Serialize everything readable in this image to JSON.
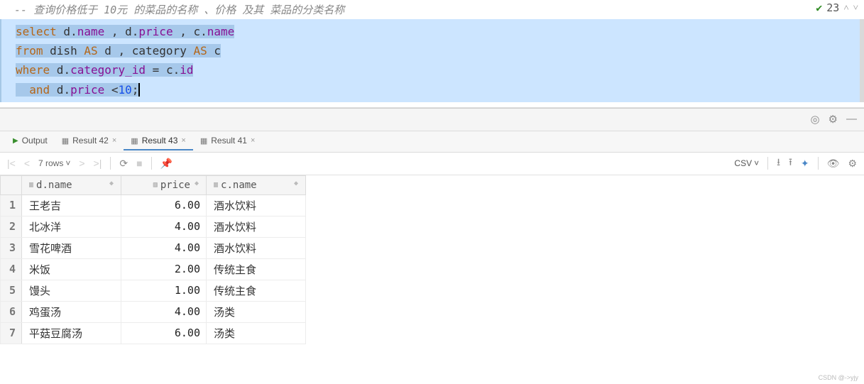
{
  "editor": {
    "comment": "--  查询价格低于 10元  的菜品的名称  、价格  及其  菜品的分类名称",
    "problems_count": "23",
    "code_tokens": {
      "l1": "select d.name , d.price , c.name",
      "l2": "from dish AS d , category AS c",
      "l3": "where d.category_id = c.id",
      "l4": "  and d.price <10;"
    }
  },
  "tabs": {
    "output": "Output",
    "result42": "Result 42",
    "result43": "Result 43",
    "result41": "Result 41"
  },
  "toolbar": {
    "rows_label": "7 rows",
    "export_format": "CSV"
  },
  "columns": {
    "dname": "d.name",
    "price": "price",
    "cname": "c.name"
  },
  "rows": [
    {
      "n": "1",
      "dname": "王老吉",
      "price": "6.00",
      "cname": "酒水饮料"
    },
    {
      "n": "2",
      "dname": "北冰洋",
      "price": "4.00",
      "cname": "酒水饮料"
    },
    {
      "n": "3",
      "dname": "雪花啤酒",
      "price": "4.00",
      "cname": "酒水饮料"
    },
    {
      "n": "4",
      "dname": "米饭",
      "price": "2.00",
      "cname": "传统主食"
    },
    {
      "n": "5",
      "dname": "馒头",
      "price": "1.00",
      "cname": "传统主食"
    },
    {
      "n": "6",
      "dname": "鸡蛋汤",
      "price": "4.00",
      "cname": "汤类"
    },
    {
      "n": "7",
      "dname": "平菇豆腐汤",
      "price": "6.00",
      "cname": "汤类"
    }
  ],
  "watermark": "CSDN @->yjy"
}
